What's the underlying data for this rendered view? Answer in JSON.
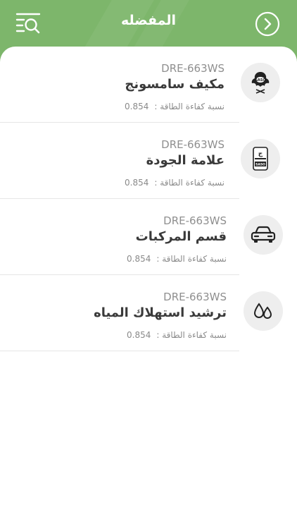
{
  "header": {
    "title": "المفضله",
    "color": "#7db66b"
  },
  "favorites": [
    {
      "code": "DRE-663WS",
      "name": "مكيف سامسونج",
      "efficiency_label": "نسبة كفاءة الطاقة :",
      "efficiency_value": "0.854",
      "icon": "sasd-falcon-logo"
    },
    {
      "code": "DRE-663WS",
      "name": "علامة الجودة",
      "efficiency_label": "نسبة كفاءة الطاقة :",
      "efficiency_value": "0.854",
      "icon": "quality-mark-badge"
    },
    {
      "code": "DRE-663WS",
      "name": "قسم المركبات",
      "efficiency_label": "نسبة كفاءة الطاقة :",
      "efficiency_value": "0.854",
      "icon": "car-icon"
    },
    {
      "code": "DRE-663WS",
      "name": "ترشيد استهلاك المياه",
      "efficiency_label": "نسبة كفاءة الطاقة :",
      "efficiency_value": "0.854",
      "icon": "water-drops-icon"
    }
  ]
}
